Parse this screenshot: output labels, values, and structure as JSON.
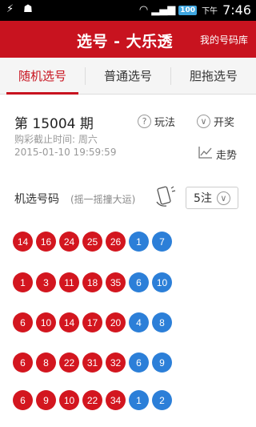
{
  "status_bar": {
    "usb_icon": "usb-icon",
    "android_icon": "android-icon",
    "battery": "100",
    "ampm": "下午",
    "time": "7:46"
  },
  "header": {
    "title": "选号 - 大乐透",
    "my_numbers": "我的号码库"
  },
  "tabs": [
    {
      "label": "随机选号",
      "active": true
    },
    {
      "label": "普通选号",
      "active": false
    },
    {
      "label": "胆拖选号",
      "active": false
    }
  ],
  "issue": {
    "title": "第 15004 期",
    "deadline_label": "购彩截止时间: 周六",
    "deadline_time": "2015-01-10 19:59:59"
  },
  "actions": {
    "rules": "玩法",
    "draw": "开奖",
    "trend": "走势"
  },
  "picker": {
    "label": "机选号码",
    "hint": "(摇一摇撞大运)",
    "count": "5注"
  },
  "rows": [
    {
      "red": [
        "14",
        "16",
        "24",
        "25",
        "26"
      ],
      "blue": [
        "1",
        "7"
      ]
    },
    {
      "red": [
        "1",
        "3",
        "11",
        "18",
        "35"
      ],
      "blue": [
        "6",
        "10"
      ]
    },
    {
      "red": [
        "6",
        "10",
        "14",
        "17",
        "20"
      ],
      "blue": [
        "4",
        "8"
      ]
    },
    {
      "red": [
        "6",
        "8",
        "22",
        "31",
        "32"
      ],
      "blue": [
        "6",
        "9"
      ]
    },
    {
      "red": [
        "6",
        "9",
        "10",
        "22",
        "34"
      ],
      "blue": [
        "1",
        "2"
      ]
    }
  ]
}
